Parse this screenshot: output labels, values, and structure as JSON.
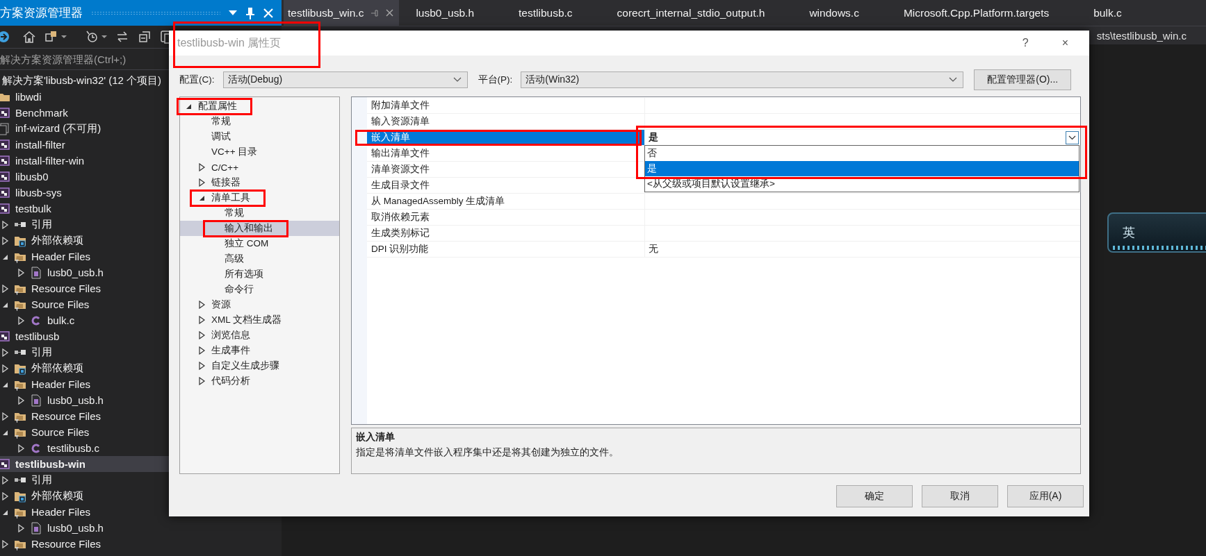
{
  "solution_explorer": {
    "title": "方案资源管理器",
    "search": {
      "placeholder": "解决方案资源管理器(Ctrl+;)"
    },
    "tree": [
      {
        "label": "解决方案'libusb-win32' (12 个项目)",
        "selected": false,
        "children": [
          {
            "label": "libwdi",
            "kind": "folder",
            "selected": false
          },
          {
            "label": "Benchmark",
            "kind": "project",
            "selected": false
          },
          {
            "label": "inf-wizard (不可用)",
            "kind": "unavailable",
            "selected": false
          },
          {
            "label": "install-filter",
            "kind": "project",
            "selected": false
          },
          {
            "label": "install-filter-win",
            "kind": "project",
            "selected": false
          },
          {
            "label": "libusb0",
            "kind": "project",
            "selected": false
          },
          {
            "label": "libusb-sys",
            "kind": "project",
            "selected": false
          },
          {
            "label": "testbulk",
            "kind": "project",
            "selected": false,
            "children": [
              {
                "label": "引用",
                "kind": "references",
                "expanded": false,
                "selected": false
              },
              {
                "label": "外部依赖项",
                "kind": "external",
                "expanded": false,
                "selected": false
              },
              {
                "label": "Header Files",
                "kind": "filter",
                "expanded": true,
                "selected": false,
                "children": [
                  {
                    "label": "lusb0_usb.h",
                    "kind": "header",
                    "expanded": false,
                    "selected": false
                  }
                ]
              },
              {
                "label": "Resource Files",
                "kind": "filter",
                "expanded": false,
                "selected": false
              },
              {
                "label": "Source Files",
                "kind": "filter",
                "expanded": true,
                "selected": false,
                "children": [
                  {
                    "label": "bulk.c",
                    "kind": "c-file",
                    "expanded": false,
                    "selected": false
                  }
                ]
              }
            ]
          },
          {
            "label": "testlibusb",
            "kind": "project",
            "selected": false,
            "children": [
              {
                "label": "引用",
                "kind": "references",
                "expanded": false,
                "selected": false
              },
              {
                "label": "外部依赖项",
                "kind": "external",
                "expanded": false,
                "selected": false
              },
              {
                "label": "Header Files",
                "kind": "filter",
                "expanded": true,
                "selected": false,
                "children": [
                  {
                    "label": "lusb0_usb.h",
                    "kind": "header",
                    "expanded": false,
                    "selected": false
                  }
                ]
              },
              {
                "label": "Resource Files",
                "kind": "filter",
                "expanded": false,
                "selected": false
              },
              {
                "label": "Source Files",
                "kind": "filter",
                "expanded": true,
                "selected": false,
                "children": [
                  {
                    "label": "testlibusb.c",
                    "kind": "c-file",
                    "expanded": false,
                    "selected": false
                  }
                ]
              }
            ]
          },
          {
            "label": "testlibusb-win",
            "kind": "project",
            "selected": true,
            "children": [
              {
                "label": "引用",
                "kind": "references",
                "expanded": false,
                "selected": false
              },
              {
                "label": "外部依赖项",
                "kind": "external",
                "expanded": false,
                "selected": false
              },
              {
                "label": "Header Files",
                "kind": "filter",
                "expanded": true,
                "selected": false,
                "children": [
                  {
                    "label": "lusb0_usb.h",
                    "kind": "header",
                    "expanded": false,
                    "selected": false
                  }
                ]
              },
              {
                "label": "Resource Files",
                "kind": "filter",
                "expanded": false,
                "selected": false
              }
            ]
          }
        ]
      }
    ]
  },
  "editor": {
    "tabs": [
      {
        "label": "testlibusb_win.c",
        "selected": true
      },
      {
        "label": "lusb0_usb.h",
        "selected": false
      },
      {
        "label": "testlibusb.c",
        "selected": false
      },
      {
        "label": "corecrt_internal_stdio_output.h",
        "selected": false
      },
      {
        "label": "windows.c",
        "selected": false
      },
      {
        "label": "Microsoft.Cpp.Platform.targets",
        "selected": false
      },
      {
        "label": "bulk.c",
        "selected": false
      }
    ],
    "path": "sts\\testlibusb_win.c",
    "language_bar": {
      "label": "英"
    }
  },
  "dialog": {
    "title": "testlibusb-win 属性页",
    "title_marked": true,
    "help": "?",
    "close": "×",
    "configuration": {
      "label": "配置(C):",
      "value": "活动(Debug)"
    },
    "platform": {
      "label": "平台(P):",
      "value": "活动(Win32)"
    },
    "manager_button": "配置管理器(O)...",
    "tree": [
      {
        "label": "配置属性",
        "expanded": true,
        "selected": false,
        "marked": true,
        "children": [
          {
            "label": "常规",
            "selected": false,
            "marked": false
          },
          {
            "label": "调试",
            "selected": false,
            "marked": false
          },
          {
            "label": "VC++ 目录",
            "selected": false,
            "marked": false
          },
          {
            "label": "C/C++",
            "expanded": false,
            "selected": false,
            "marked": false
          },
          {
            "label": "链接器",
            "expanded": false,
            "selected": false,
            "marked": false
          },
          {
            "label": "清单工具",
            "expanded": true,
            "selected": false,
            "marked": true,
            "children": [
              {
                "label": "常规",
                "selected": false,
                "marked": false
              },
              {
                "label": "输入和输出",
                "selected": true,
                "marked": true
              },
              {
                "label": "独立 COM",
                "selected": false,
                "marked": false
              },
              {
                "label": "高级",
                "selected": false,
                "marked": false
              },
              {
                "label": "所有选项",
                "selected": false,
                "marked": false
              },
              {
                "label": "命令行",
                "selected": false,
                "marked": false
              }
            ]
          },
          {
            "label": "资源",
            "expanded": false,
            "selected": false,
            "marked": false
          },
          {
            "label": "XML 文档生成器",
            "expanded": false,
            "selected": false,
            "marked": false
          },
          {
            "label": "浏览信息",
            "expanded": false,
            "selected": false,
            "marked": false
          },
          {
            "label": "生成事件",
            "expanded": false,
            "selected": false,
            "marked": false
          },
          {
            "label": "自定义生成步骤",
            "expanded": false,
            "selected": false,
            "marked": false
          },
          {
            "label": "代码分析",
            "expanded": false,
            "selected": false,
            "marked": false
          }
        ]
      }
    ],
    "properties": [
      {
        "name": "附加清单文件",
        "selected": false,
        "marked": false
      },
      {
        "name": "输入资源清单",
        "selected": false,
        "marked": false
      },
      {
        "name": "嵌入清单",
        "value": "是",
        "selected": true,
        "marked": true
      },
      {
        "name": "输出清单文件",
        "selected": false,
        "marked": false
      },
      {
        "name": "清单资源文件",
        "selected": false,
        "marked": false
      },
      {
        "name": "生成目录文件",
        "selected": false,
        "marked": false
      },
      {
        "name": "从 ManagedAssembly 生成清单",
        "selected": false,
        "marked": false
      },
      {
        "name": "取消依赖元素",
        "selected": false,
        "marked": false
      },
      {
        "name": "生成类别标记",
        "selected": false,
        "marked": false
      },
      {
        "name": "DPI 识别功能",
        "value": "无",
        "selected": false,
        "marked": false
      }
    ],
    "dropdown": {
      "marked": true,
      "options": [
        {
          "label": "否",
          "selected": false
        },
        {
          "label": "是",
          "selected": true
        },
        {
          "label": "<从父级或项目默认设置继承>",
          "selected": false
        }
      ]
    },
    "description": {
      "title": "嵌入清单",
      "text": "指定是将清单文件嵌入程序集中还是将其创建为独立的文件。"
    },
    "buttons": [
      "确定",
      "取消",
      "应用(A)"
    ]
  }
}
